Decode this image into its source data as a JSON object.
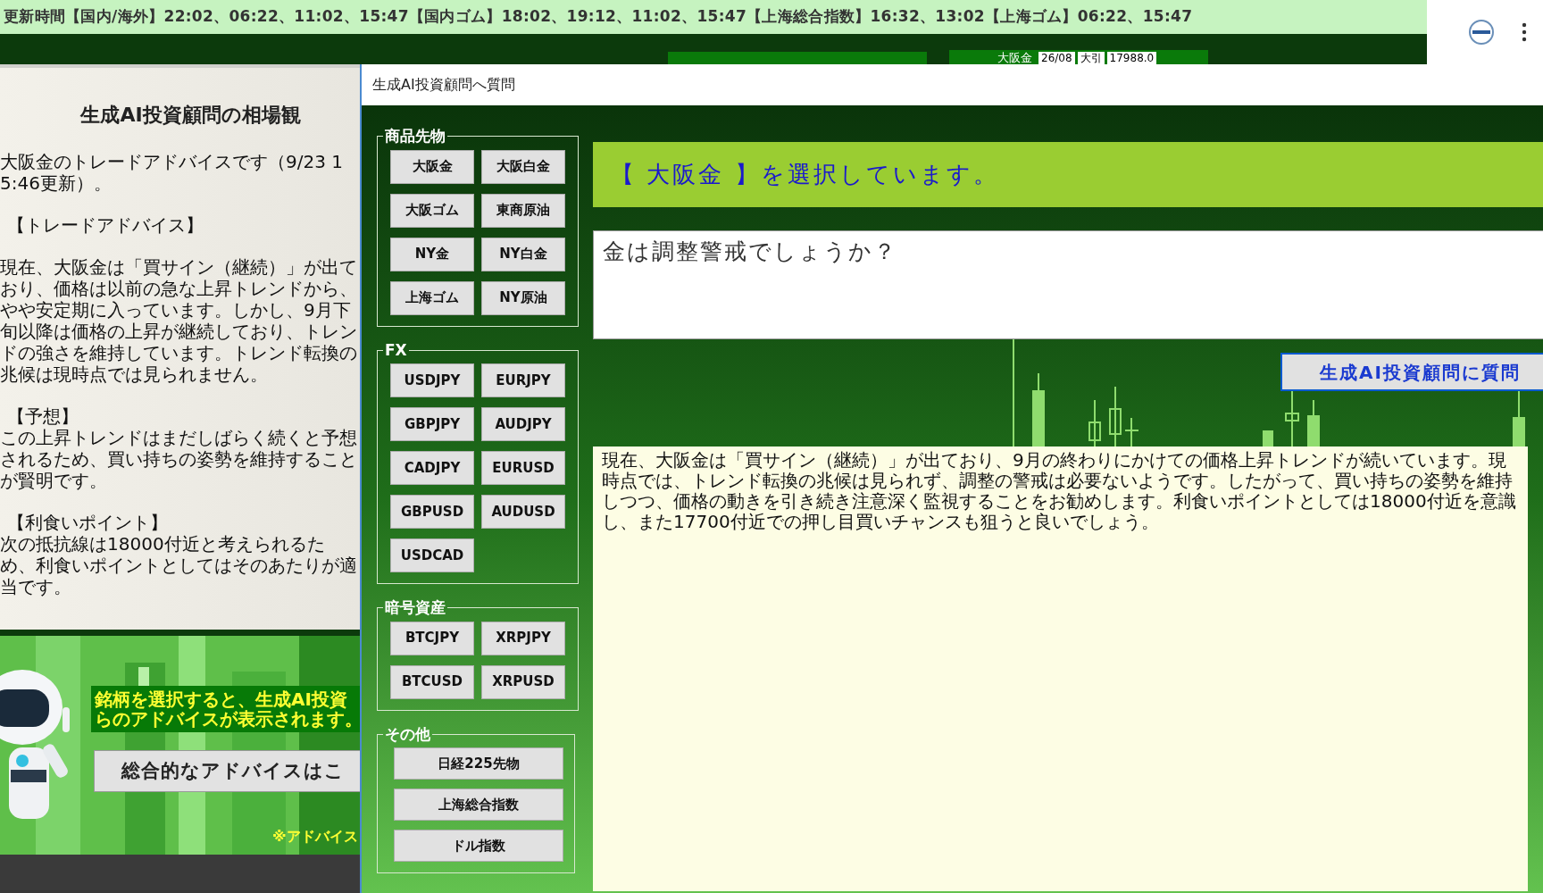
{
  "ticker_bar": {
    "text": "更新時間【国内/海外】22:02、06:22、11:02、15:47【国内ゴム】18:02、19:12、11:02、15:47【上海総合指数】16:32、13:02【上海ゴム】06:22、15:47"
  },
  "back_window": {
    "label": "大阪金",
    "cells": [
      "26/08",
      "大引",
      "17988.0"
    ]
  },
  "left_panel": {
    "title": "生成AI投資顧問の相場観",
    "sections": [
      {
        "body": "大阪金のトレードアドバイスです（9/23 15:46更新）。"
      },
      {
        "heading": "【トレードアドバイス】"
      },
      {
        "body": "現在、大阪金は「買サイン（継続）」が出ており、価格は以前の急な上昇トレンドから、やや安定期に入っています。しかし、9月下旬以降は価格の上昇が継続しており、トレンドの強さを維持しています。トレンド転換の兆候は現時点では見られません。"
      },
      {
        "heading": "【予想】",
        "body": "この上昇トレンドはまだしばらく続くと予想されるため、買い持ちの姿勢を維持することが賢明です。"
      },
      {
        "heading": "【利食いポイント】",
        "body": "次の抵抗線は18000付近と考えられるため、利食いポイントとしてはそのあたりが適当です。"
      }
    ]
  },
  "banner": {
    "message_lines": [
      "銘柄を選択すると、生成AI投資",
      "らのアドバイスが表示されます。"
    ],
    "button": "総合的なアドバイスはこ",
    "note": "※アドバイス"
  },
  "dialog": {
    "title": "生成AI投資顧問へ質問",
    "groups": [
      {
        "label": "商品先物",
        "kind": "grid",
        "buttons": [
          "大阪金",
          "大阪白金",
          "大阪ゴム",
          "東商原油",
          "NY金",
          "NY白金",
          "上海ゴム",
          "NY原油"
        ]
      },
      {
        "label": "FX",
        "kind": "grid",
        "buttons": [
          "USDJPY",
          "EURJPY",
          "GBPJPY",
          "AUDJPY",
          "CADJPY",
          "EURUSD",
          "GBPUSD",
          "AUDUSD",
          "USDCAD"
        ]
      },
      {
        "label": "暗号資産",
        "kind": "grid",
        "buttons": [
          "BTCJPY",
          "XRPJPY",
          "BTCUSD",
          "XRPUSD"
        ]
      },
      {
        "label": "その他",
        "kind": "list",
        "buttons": [
          "日経225先物",
          "上海総合指数",
          "ドル指数"
        ]
      }
    ],
    "selection": "【 大阪金 】を選択しています。",
    "question": "金は調整警戒でしょうか？",
    "ask_button": "生成AI投資顧問に質問",
    "answer": "現在、大阪金は「買サイン（継続）」が出ており、9月の終わりにかけての価格上昇トレンドが続いています。現時点では、トレンド転換の兆候は見られず、調整の警戒は必要ないようです。したがって、買い持ちの姿勢を維持しつつ、価格の動きを引き続き注意深く監視することをお勧めします。利食いポイントとしては18000付近を意識し、また17700付近での押し目買いチャンスも狙うと良いでしょう。"
  }
}
